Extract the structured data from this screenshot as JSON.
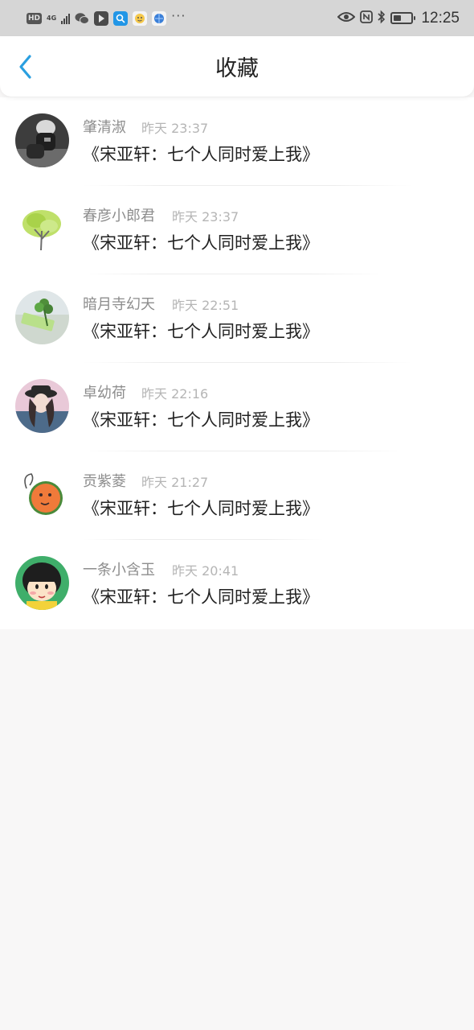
{
  "status_bar": {
    "hd": "HD",
    "network": "4G",
    "time": "12:25",
    "more": "···",
    "battery_level": 0.45,
    "icons": [
      "hd-icon",
      "signal-icon",
      "wechat-icon",
      "app-icon",
      "search-app-icon",
      "emoji-app-icon",
      "browser-app-icon",
      "eye-icon",
      "nfc-icon",
      "bluetooth-icon",
      "battery-icon"
    ]
  },
  "header": {
    "title": "收藏",
    "back_icon": "chevron-left-icon"
  },
  "items": [
    {
      "name": "肇清淑",
      "time": "昨天 23:37",
      "title": "《宋亚轩：七个人同时爱上我》",
      "avatar": "photo-avatar"
    },
    {
      "name": "春彦小郎君",
      "time": "昨天 23:37",
      "title": "《宋亚轩：七个人同时爱上我》",
      "avatar": "tree-avatar"
    },
    {
      "name": "暗月寺幻天",
      "time": "昨天 22:51",
      "title": "《宋亚轩：七个人同时爱上我》",
      "avatar": "clover-avatar"
    },
    {
      "name": "卓幼荷",
      "time": "昨天 22:16",
      "title": "《宋亚轩：七个人同时爱上我》",
      "avatar": "girl-avatar"
    },
    {
      "name": "贡紫菱",
      "time": "昨天 21:27",
      "title": "《宋亚轩：七个人同时爱上我》",
      "avatar": "orange-avatar"
    },
    {
      "name": "一条小含玉",
      "time": "昨天 20:41",
      "title": "《宋亚轩：七个人同时爱上我》",
      "avatar": "cartoon-avatar"
    }
  ],
  "colors": {
    "accent": "#2a9fe0",
    "page_background": "#f8f7f7",
    "status_bar": "#d6d6d6"
  }
}
